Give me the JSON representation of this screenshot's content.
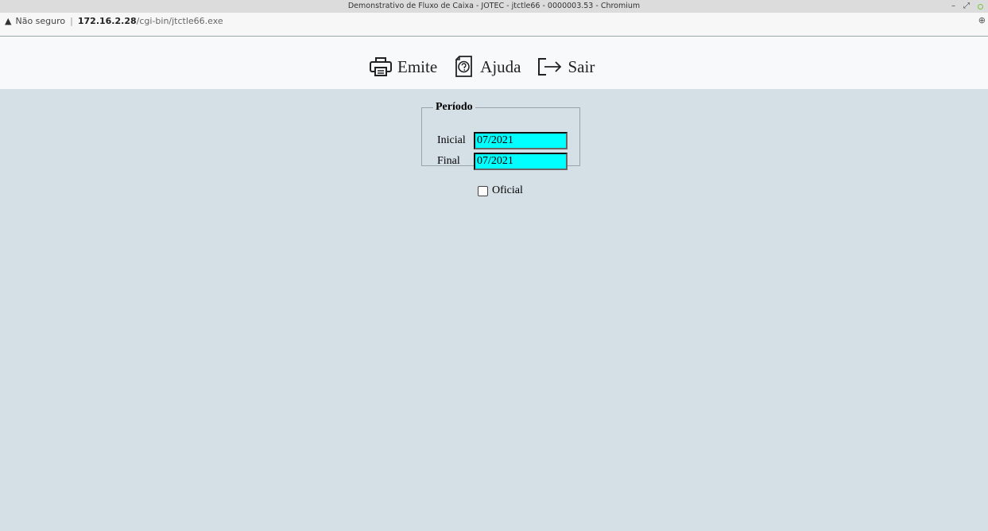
{
  "window": {
    "title": "Demonstrativo de Fluxo de Caixa - JOTEC - jtctle66 - 0000003.53 - Chromium",
    "controls": [
      "–",
      "⤢"
    ]
  },
  "address": {
    "security": "Não seguro",
    "host": "172.16.2.28",
    "path": "/cgi-bin/jtctle66.exe"
  },
  "toolbar": {
    "emite_label": "Emite",
    "ajuda_label": "Ajuda",
    "sair_label": "Sair"
  },
  "periodo": {
    "legend": "Período",
    "inicial_label": "Inicial",
    "inicial_value": "07/2021",
    "final_label": "Final",
    "final_value": "07/2021"
  },
  "oficial": {
    "label": "Oficial",
    "checked": false
  },
  "colors": {
    "background": "#d5dfe6",
    "field": "#00ffff",
    "toolbar": "#f8f9fb"
  }
}
